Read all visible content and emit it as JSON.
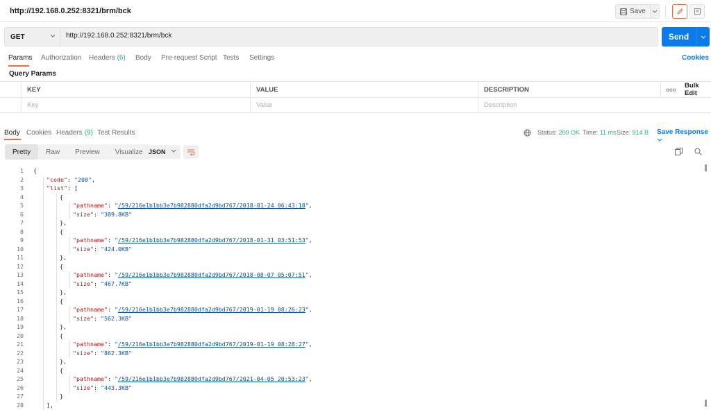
{
  "window": {
    "title": "http://192.168.0.252:8321/brm/bck"
  },
  "toolbar": {
    "save_label": "Save"
  },
  "request": {
    "method": "GET",
    "url": "http://192.168.0.252:8321/brm/bck",
    "send_label": "Send",
    "tabs": [
      {
        "label": "Params",
        "count": ""
      },
      {
        "label": "Authorization",
        "count": ""
      },
      {
        "label": "Headers",
        "count": "(6)"
      },
      {
        "label": "Body",
        "count": ""
      },
      {
        "label": "Pre-request Script",
        "count": ""
      },
      {
        "label": "Tests",
        "count": ""
      },
      {
        "label": "Settings",
        "count": ""
      }
    ],
    "cookies_label": "Cookies",
    "query_params_title": "Query Params",
    "table": {
      "headers": [
        "KEY",
        "VALUE",
        "DESCRIPTION"
      ],
      "placeholders": [
        "Key",
        "Value",
        "Description"
      ],
      "more_label": "ooo",
      "bulk_edit_label": "Bulk Edit"
    }
  },
  "response": {
    "tabs": [
      {
        "label": "Body",
        "count": ""
      },
      {
        "label": "Cookies",
        "count": ""
      },
      {
        "label": "Headers",
        "count": "(9)"
      },
      {
        "label": "Test Results",
        "count": ""
      }
    ],
    "status_label": "Status:",
    "status_value": "200 OK",
    "time_label": "Time:",
    "time_value": "11 ms",
    "size_label": "Size:",
    "size_value": "914 B",
    "save_response_label": "Save Response",
    "format_buttons": [
      "Pretty",
      "Raw",
      "Preview",
      "Visualize"
    ],
    "format_selected": "JSON",
    "code_lines": [
      {
        "n": "1",
        "indent": 0,
        "parts": [
          [
            "p",
            "{"
          ]
        ]
      },
      {
        "n": "2",
        "indent": 1,
        "parts": [
          [
            "k",
            "\"code\""
          ],
          [
            "p",
            ": "
          ],
          [
            "s",
            "\"200\""
          ],
          [
            "p",
            ","
          ]
        ]
      },
      {
        "n": "3",
        "indent": 1,
        "parts": [
          [
            "k",
            "\"list\""
          ],
          [
            "p",
            ": ["
          ]
        ]
      },
      {
        "n": "4",
        "indent": 2,
        "parts": [
          [
            "p",
            "{"
          ]
        ]
      },
      {
        "n": "5",
        "indent": 3,
        "parts": [
          [
            "k",
            "\"pathname\""
          ],
          [
            "p",
            ": "
          ],
          [
            "s",
            "\""
          ],
          [
            "lnk",
            "/59/216e1b1bb3e7b982880dfa2d9bd767/2018-01-24_06:43:18"
          ],
          [
            "s",
            "\""
          ],
          [
            "p",
            ","
          ]
        ]
      },
      {
        "n": "6",
        "indent": 3,
        "parts": [
          [
            "k",
            "\"size\""
          ],
          [
            "p",
            ": "
          ],
          [
            "s",
            "\"389.8KB\""
          ]
        ]
      },
      {
        "n": "7",
        "indent": 2,
        "parts": [
          [
            "p",
            "},"
          ]
        ]
      },
      {
        "n": "8",
        "indent": 2,
        "parts": [
          [
            "p",
            "{"
          ]
        ]
      },
      {
        "n": "9",
        "indent": 3,
        "parts": [
          [
            "k",
            "\"pathname\""
          ],
          [
            "p",
            ": "
          ],
          [
            "s",
            "\""
          ],
          [
            "lnk",
            "/59/216e1b1bb3e7b982880dfa2d9bd767/2018-01-31_03:51:53"
          ],
          [
            "s",
            "\""
          ],
          [
            "p",
            ","
          ]
        ]
      },
      {
        "n": "10",
        "indent": 3,
        "parts": [
          [
            "k",
            "\"size\""
          ],
          [
            "p",
            ": "
          ],
          [
            "s",
            "\"424.0KB\""
          ]
        ]
      },
      {
        "n": "11",
        "indent": 2,
        "parts": [
          [
            "p",
            "},"
          ]
        ]
      },
      {
        "n": "12",
        "indent": 2,
        "parts": [
          [
            "p",
            "{"
          ]
        ]
      },
      {
        "n": "13",
        "indent": 3,
        "parts": [
          [
            "k",
            "\"pathname\""
          ],
          [
            "p",
            ": "
          ],
          [
            "s",
            "\""
          ],
          [
            "lnk",
            "/59/216e1b1bb3e7b982880dfa2d9bd767/2018-08-07_05:07:51"
          ],
          [
            "s",
            "\""
          ],
          [
            "p",
            ","
          ]
        ]
      },
      {
        "n": "14",
        "indent": 3,
        "parts": [
          [
            "k",
            "\"size\""
          ],
          [
            "p",
            ": "
          ],
          [
            "s",
            "\"467.7KB\""
          ]
        ]
      },
      {
        "n": "15",
        "indent": 2,
        "parts": [
          [
            "p",
            "},"
          ]
        ]
      },
      {
        "n": "16",
        "indent": 2,
        "parts": [
          [
            "p",
            "{"
          ]
        ]
      },
      {
        "n": "17",
        "indent": 3,
        "parts": [
          [
            "k",
            "\"pathname\""
          ],
          [
            "p",
            ": "
          ],
          [
            "s",
            "\""
          ],
          [
            "lnk",
            "/59/216e1b1bb3e7b982880dfa2d9bd767/2019-01-19_08:26:23"
          ],
          [
            "s",
            "\""
          ],
          [
            "p",
            ","
          ]
        ]
      },
      {
        "n": "18",
        "indent": 3,
        "parts": [
          [
            "k",
            "\"size\""
          ],
          [
            "p",
            ": "
          ],
          [
            "s",
            "\"562.3KB\""
          ]
        ]
      },
      {
        "n": "19",
        "indent": 2,
        "parts": [
          [
            "p",
            "},"
          ]
        ]
      },
      {
        "n": "20",
        "indent": 2,
        "parts": [
          [
            "p",
            "{"
          ]
        ]
      },
      {
        "n": "21",
        "indent": 3,
        "parts": [
          [
            "k",
            "\"pathname\""
          ],
          [
            "p",
            ": "
          ],
          [
            "s",
            "\""
          ],
          [
            "lnk",
            "/59/216e1b1bb3e7b982880dfa2d9bd767/2019-01-19_08:28:27"
          ],
          [
            "s",
            "\""
          ],
          [
            "p",
            ","
          ]
        ]
      },
      {
        "n": "22",
        "indent": 3,
        "parts": [
          [
            "k",
            "\"size\""
          ],
          [
            "p",
            ": "
          ],
          [
            "s",
            "\"862.3KB\""
          ]
        ]
      },
      {
        "n": "23",
        "indent": 2,
        "parts": [
          [
            "p",
            "},"
          ]
        ]
      },
      {
        "n": "24",
        "indent": 2,
        "parts": [
          [
            "p",
            "{"
          ]
        ]
      },
      {
        "n": "25",
        "indent": 3,
        "parts": [
          [
            "k",
            "\"pathname\""
          ],
          [
            "p",
            ": "
          ],
          [
            "s",
            "\""
          ],
          [
            "lnk",
            "/59/216e1b1bb3e7b982880dfa2d9bd767/2021-04-05_20:53:23"
          ],
          [
            "s",
            "\""
          ],
          [
            "p",
            ","
          ]
        ]
      },
      {
        "n": "26",
        "indent": 3,
        "parts": [
          [
            "k",
            "\"size\""
          ],
          [
            "p",
            ": "
          ],
          [
            "s",
            "\"443.3KB\""
          ]
        ]
      },
      {
        "n": "27",
        "indent": 2,
        "parts": [
          [
            "p",
            "}"
          ]
        ]
      },
      {
        "n": "28",
        "indent": 1,
        "parts": [
          [
            "p",
            "],"
          ]
        ]
      }
    ]
  },
  "colors": {
    "accent": "#f26b3a",
    "brand_blue": "#097bed",
    "success": "#26b47f",
    "json_key": "#a31515",
    "json_string": "#0451a5"
  }
}
